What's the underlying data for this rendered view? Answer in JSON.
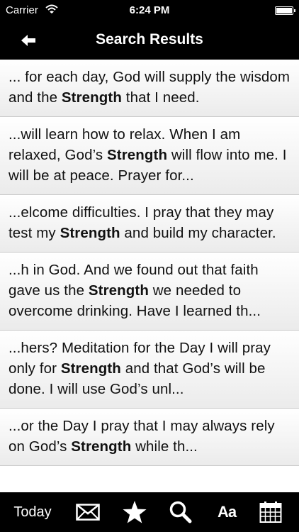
{
  "status": {
    "carrier": "Carrier",
    "time": "6:24 PM"
  },
  "nav": {
    "title": "Search Results"
  },
  "results": [
    {
      "before": "... for each day, God will supply the wisdom and the ",
      "match": "Strength",
      "after": " that I need."
    },
    {
      "before": "...will learn how to relax. When I am relaxed, God’s ",
      "match": "Strength",
      "after": " will flow into me. I will be at peace. Prayer for..."
    },
    {
      "before": "...elcome difficulties. I pray that they may test my ",
      "match": "Strength",
      "after": " and build my character."
    },
    {
      "before": "...h in God. And we found out that faith gave us the ",
      "match": "Strength",
      "after": " we needed to overcome drinking. Have I learned th..."
    },
    {
      "before": "...hers? Meditation for the Day I will pray only for ",
      "match": "Strength",
      "after": " and that God’s will be done. I will use God’s unl..."
    },
    {
      "before": "...or the Day I pray that I may always rely on God’s ",
      "match": "Strength",
      "after": " while th..."
    }
  ],
  "tabs": {
    "today_label": "Today",
    "fontsize_label": "Aa"
  },
  "icons": {
    "back": "arrow-left-icon",
    "mail": "envelope-icon",
    "favorites": "star-icon",
    "search": "magnifier-icon",
    "calendar": "calendar-icon",
    "wifi": "wifi-icon",
    "battery": "battery-icon"
  }
}
